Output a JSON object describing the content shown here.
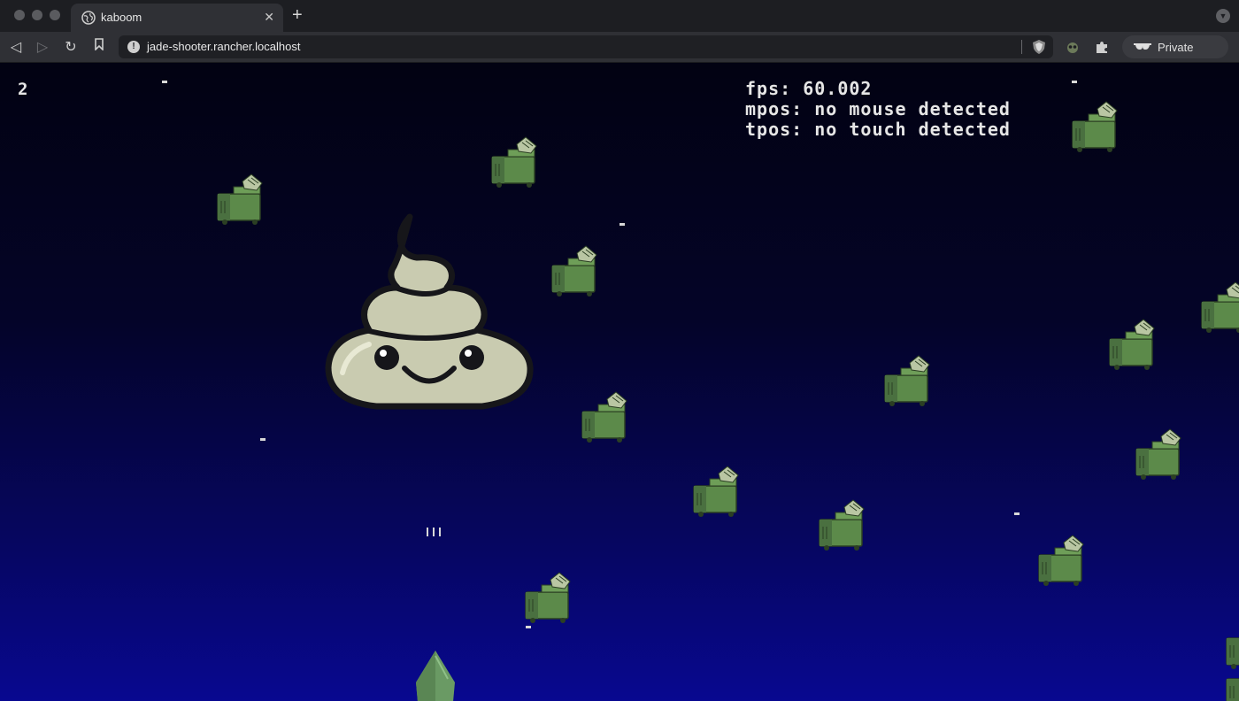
{
  "browser": {
    "tab_title": "kaboom",
    "url": "jade-shooter.rancher.localhost",
    "private_label": "Private",
    "new_tab_glyph": "+",
    "close_tab_glyph": "✕",
    "icons": [
      "globe-icon",
      "close-icon",
      "plus-icon",
      "back-icon",
      "forward-icon",
      "reload-icon",
      "bookmark-icon",
      "info-icon",
      "brave-shield-icon",
      "extension-mask-icon",
      "puzzle-icon",
      "private-glasses-icon",
      "chevron-down-icon"
    ]
  },
  "game": {
    "score": "2",
    "debug": {
      "fps": "fps: 60.002",
      "mpos": "mpos: no mouse detected",
      "tpos": "tpos: no touch detected"
    },
    "colors": {
      "bg_top": "#020212",
      "bg_bottom": "#080890",
      "enemy_green": "#5c8a4a",
      "boss_body": "#c9cbb0",
      "player_green": "#6a9a64"
    },
    "sprites": [
      "poop-boss",
      "player-ship",
      "dumpster-enemy",
      "bullet",
      "star"
    ]
  }
}
